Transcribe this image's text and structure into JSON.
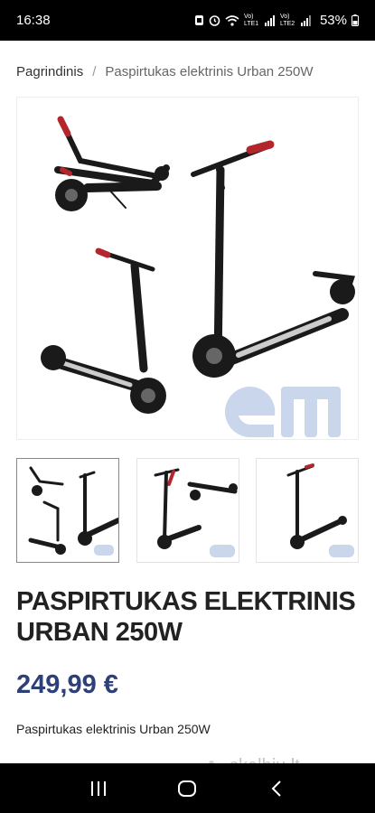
{
  "status_bar": {
    "time": "16:38",
    "network_labels": [
      "Vo) LTE1",
      "Vo) LTE2"
    ],
    "battery": "53%"
  },
  "breadcrumb": {
    "home": "Pagrindinis",
    "separator": "/",
    "current": "Paspirtukas elektrinis Urban 250W"
  },
  "product": {
    "title": "PASPIRTUKAS ELEKTRINIS URBAN 250W",
    "price": "249,99 €",
    "description": "Paspirtukas elektrinis Urban 250W",
    "image_logo": "em"
  },
  "watermark": "skelbiu.lt",
  "colors": {
    "price": "#2d4178",
    "logo": "#c9d6ec",
    "scooter": "#1a1a1a",
    "grip": "#b3262b"
  },
  "icons": {
    "recents": "recents-icon",
    "home": "home-icon",
    "back": "back-icon"
  }
}
